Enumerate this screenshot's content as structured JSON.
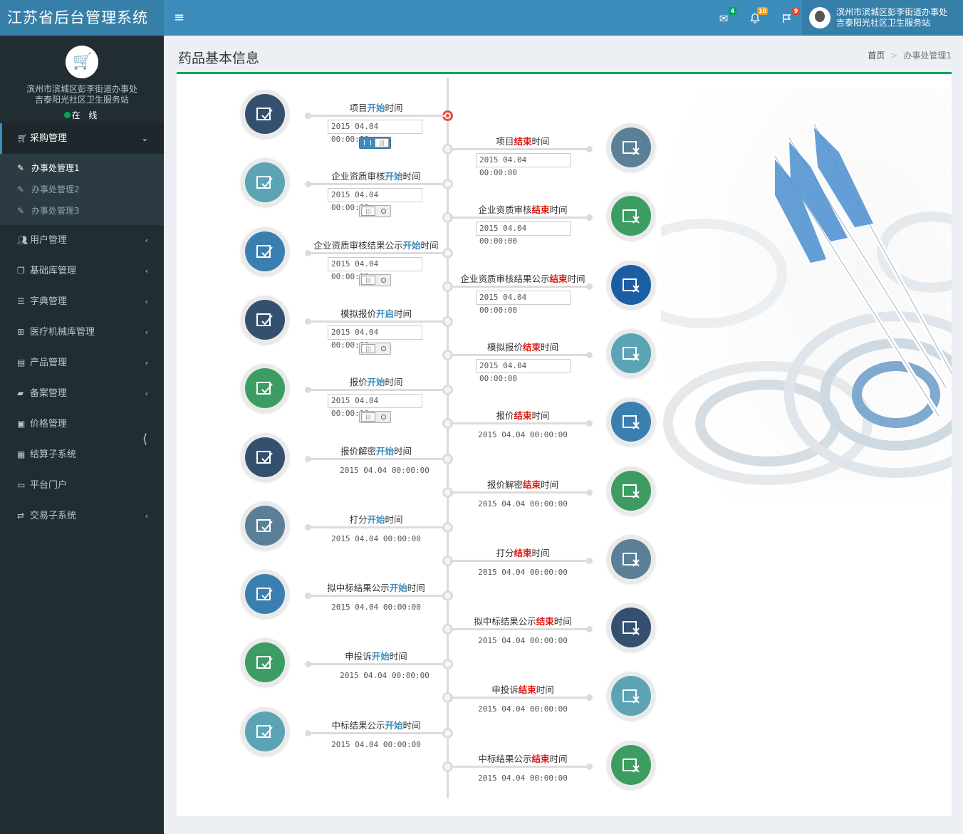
{
  "app": {
    "title": "江苏省后台管理系统",
    "menu_toggle": "≡"
  },
  "header": {
    "mail_badge": "4",
    "bell_badge": "10",
    "flag_badge": "9",
    "user_line1": "滨州市滨城区彭李街道办事处",
    "user_line2": "吉泰阳光社区卫生服务站",
    "colors": {
      "mail_badge": "#00a65a",
      "bell_badge": "#f39c12",
      "flag_badge": "#dd4b39"
    }
  },
  "sidebar": {
    "org_line1": "滨州市滨城区彭李街道办事处",
    "org_line2": "吉泰阳光社区卫生服务站",
    "status": "在 线",
    "menu": [
      {
        "label": "采购管理",
        "icon": "cart-icon"
      },
      {
        "label": "用户管理",
        "icon": "users-icon"
      },
      {
        "label": "基础库管理",
        "icon": "copy-icon"
      },
      {
        "label": "字典管理",
        "icon": "list-icon"
      },
      {
        "label": "医疗机械库管理",
        "icon": "medkit-icon"
      },
      {
        "label": "产品管理",
        "icon": "card-icon"
      },
      {
        "label": "备案管理",
        "icon": "book-icon"
      },
      {
        "label": "价格管理",
        "icon": "money-icon"
      },
      {
        "label": "结算子系统",
        "icon": "calculator-icon"
      },
      {
        "label": "平台门户",
        "icon": "desktop-icon"
      },
      {
        "label": "交易子系统",
        "icon": "retweet-icon"
      }
    ],
    "submenu": [
      {
        "label": "办事处管理1"
      },
      {
        "label": "办事处管理2"
      },
      {
        "label": "办事处管理3"
      }
    ]
  },
  "page": {
    "title": "药品基本信息",
    "breadcrumb_home": "首页",
    "breadcrumb_sep": ">",
    "breadcrumb_current": "办事处管理1"
  },
  "timeline": {
    "datetime": "2015 04.04 00:00:00",
    "start_word": "开始",
    "end_word": "结束",
    "open_word": "开启",
    "suffix": "时间",
    "items": [
      {
        "prefix": "项目",
        "start_hl": "开始",
        "end_hl": "结束"
      },
      {
        "prefix": "企业资质审核",
        "start_hl": "开始",
        "end_hl": "结束"
      },
      {
        "prefix": "企业资质审核结果公示",
        "start_hl": "开始",
        "end_hl": "结束"
      },
      {
        "prefix": "模拟报价",
        "start_hl": "开启",
        "end_hl": "结束"
      },
      {
        "prefix": "报价",
        "start_hl": "开始",
        "end_hl": "结束"
      },
      {
        "prefix": "报价解密",
        "start_hl": "开始",
        "end_hl": "结束"
      },
      {
        "prefix": "打分",
        "start_hl": "开始",
        "end_hl": "结束"
      },
      {
        "prefix": "拟中标结果公示",
        "start_hl": "开始",
        "end_hl": "结束"
      },
      {
        "prefix": "申投诉",
        "start_hl": "开始",
        "end_hl": "结束"
      },
      {
        "prefix": "中标结果公示",
        "start_hl": "开始",
        "end_hl": "结束"
      }
    ],
    "toggles": [
      "on",
      "off",
      "off",
      "off",
      "off"
    ],
    "colors": {
      "navy": "#35506e",
      "teal": "#5ba3b5",
      "blue": "#3a7fb0",
      "green": "#3c9c62",
      "slate": "#5b7f97",
      "darkblue": "#1b5ea3"
    }
  }
}
